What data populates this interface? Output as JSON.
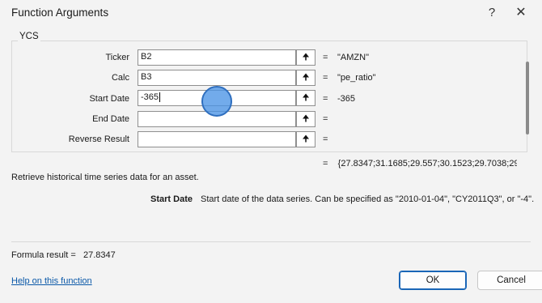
{
  "window": {
    "title": "Function Arguments",
    "help_glyph": "?",
    "close_glyph": "✕"
  },
  "function": {
    "name": "YCS",
    "arguments": [
      {
        "label": "Ticker",
        "value": "B2",
        "result": "\"AMZN\""
      },
      {
        "label": "Calc",
        "value": "B3",
        "result": "\"pe_ratio\""
      },
      {
        "label": "Start Date",
        "value": "-365",
        "result": "-365"
      },
      {
        "label": "End Date",
        "value": "",
        "result": ""
      },
      {
        "label": "Reverse Result",
        "value": "",
        "result": ""
      }
    ],
    "ref_button_glyph": "🠉",
    "equals": "=",
    "overall_result": "{27.8347;31.1685;29.557;30.1523;29.7038;29.2",
    "description": "Retrieve historical time series data for an asset."
  },
  "arg_help": {
    "label": "Start Date",
    "text": "Start date of the data series. Can be specified as \"2010-01-04\", \"CY2011Q3\", or \"-4\"."
  },
  "footer": {
    "formula_result_label": "Formula result =",
    "formula_result_value": "27.8347",
    "help_link": "Help on this function",
    "ok_label": "OK",
    "cancel_label": "Cancel"
  }
}
